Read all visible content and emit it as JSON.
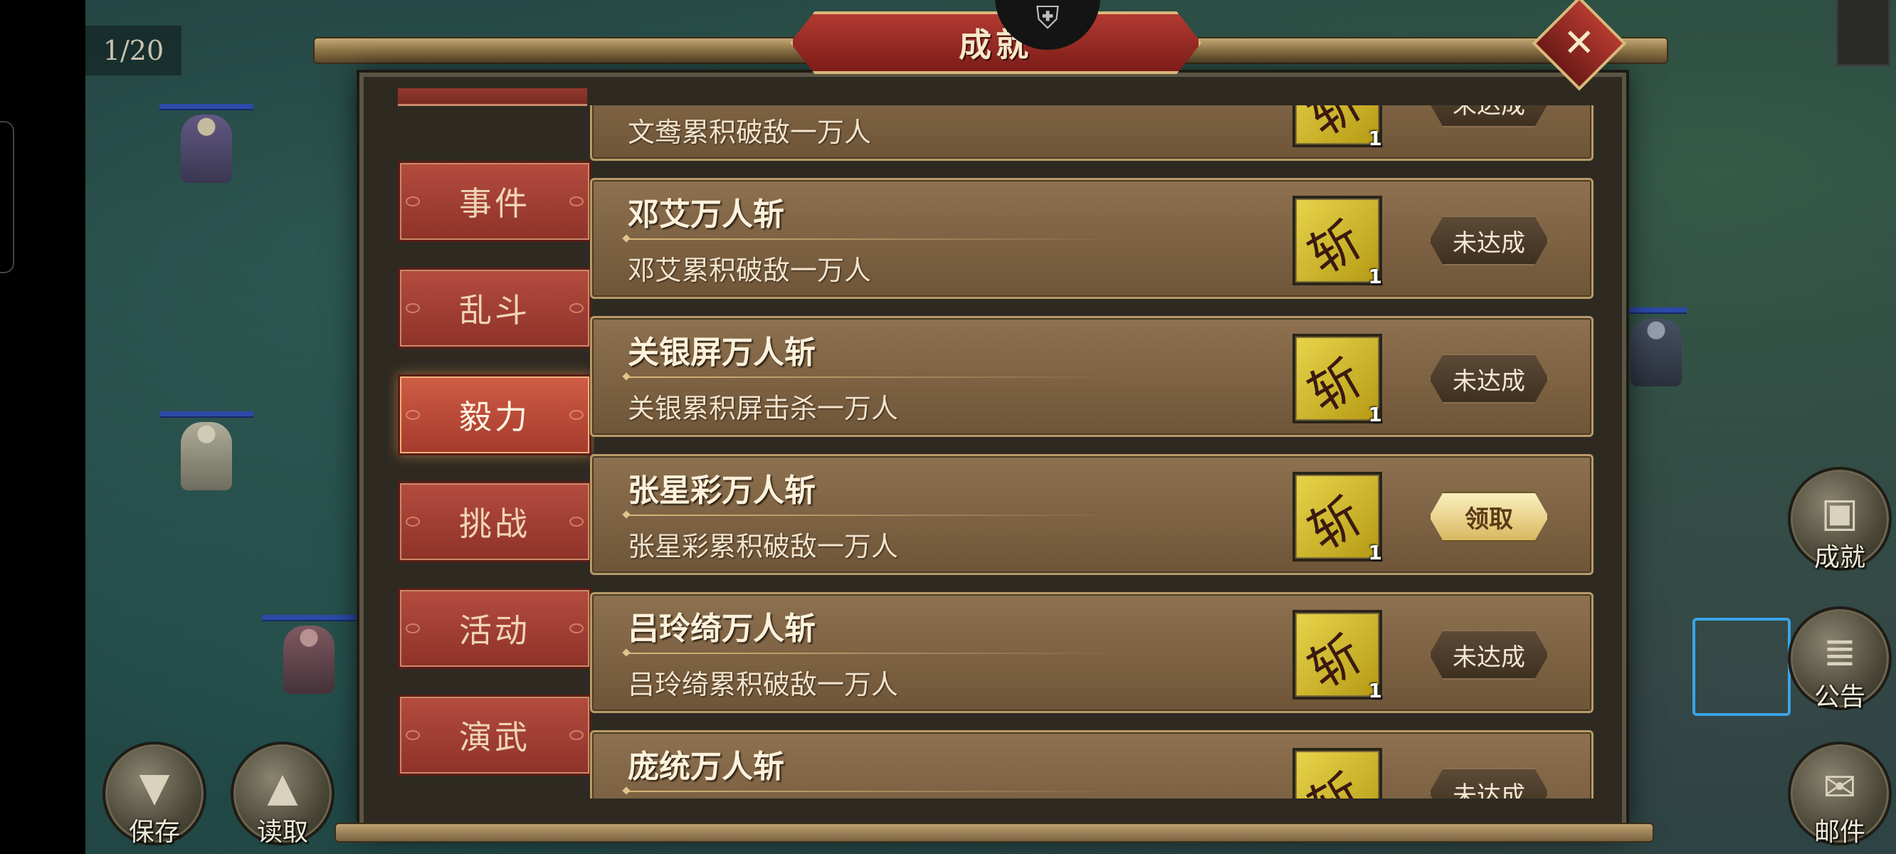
{
  "hud": {
    "counter": "1/20",
    "save_label": "保存",
    "load_label": "读取",
    "achievement_label": "成就",
    "notice_label": "公告",
    "mail_label": "邮件"
  },
  "dialog": {
    "title": "成就",
    "close_glyph": "✕"
  },
  "sidebar": {
    "tabs": [
      {
        "label": "事件",
        "active": false
      },
      {
        "label": "乱斗",
        "active": false
      },
      {
        "label": "毅力",
        "active": true
      },
      {
        "label": "挑战",
        "active": false
      },
      {
        "label": "活动",
        "active": false
      },
      {
        "label": "演武",
        "active": false
      }
    ]
  },
  "achievements": [
    {
      "name": "",
      "desc": "文鸯累积破敌一万人",
      "qty": "1",
      "status": "未达成"
    },
    {
      "name": "邓艾万人斩",
      "desc": "邓艾累积破敌一万人",
      "qty": "1",
      "status": "未达成"
    },
    {
      "name": "关银屏万人斩",
      "desc": "关银累积屏击杀一万人",
      "qty": "1",
      "status": "未达成"
    },
    {
      "name": "张星彩万人斩",
      "desc": "张星彩累积破敌一万人",
      "qty": "1",
      "status": "领取"
    },
    {
      "name": "吕玲绮万人斩",
      "desc": "吕玲绮累积破敌一万人",
      "qty": "1",
      "status": "未达成"
    },
    {
      "name": "庞统万人斩",
      "desc": "",
      "qty": "",
      "status": "未达成"
    }
  ],
  "icons": {
    "reward": "battle-axe-icon",
    "save": "scroll-down-icon",
    "load": "scroll-up-icon",
    "achievement": "treasure-icon",
    "notice": "scroll-icon",
    "mail": "mail-icon"
  },
  "colors": {
    "tab_red": "#b44c3f",
    "row_brown": "#8d7150",
    "claim_gold": "#d9b860",
    "title_red": "#b23a32"
  }
}
